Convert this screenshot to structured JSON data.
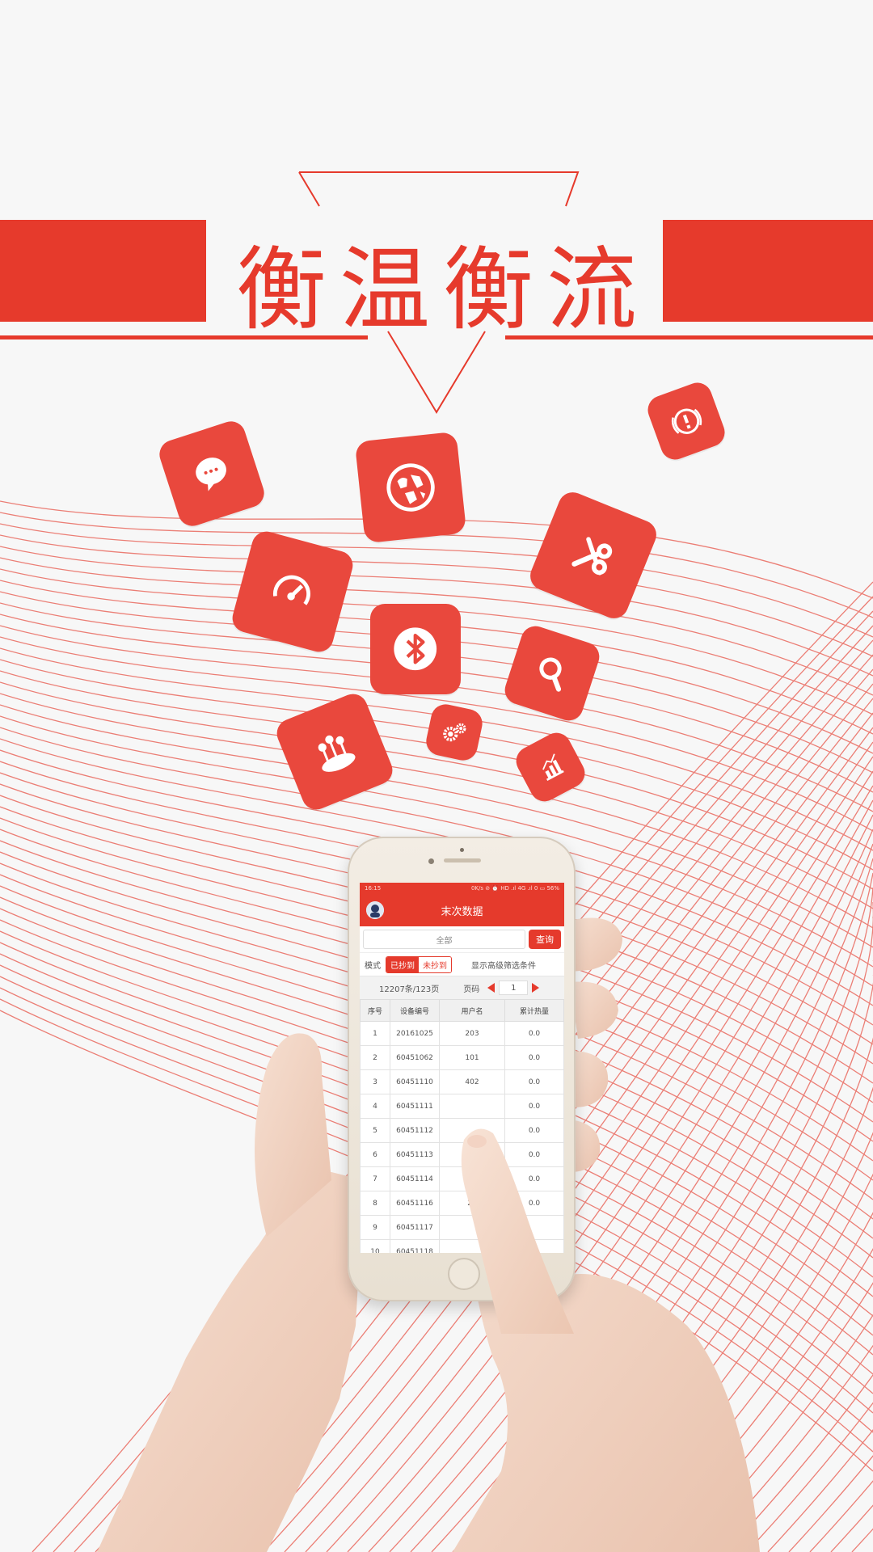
{
  "brand": {
    "title": "衡温衡流",
    "accent": "#e63a2c"
  },
  "icons": [
    "chat-bubble-icon",
    "globe-icon",
    "alert-icon",
    "speedometer-icon",
    "tools-icon",
    "bluetooth-icon",
    "search-icon",
    "network-icon",
    "gears-icon",
    "chart-icon"
  ],
  "phone": {
    "status": {
      "time": "16:15",
      "right": "0K/s ⊘ ⏰ HD .ıl 4G .ıl 0 ▭ 56%"
    },
    "appbar": {
      "title": "末次数据"
    },
    "search": {
      "value": "全部",
      "button": "查询"
    },
    "mode": {
      "label": "模式",
      "on": "已抄到",
      "off": "未抄到",
      "advanced": "显示高级筛选条件"
    },
    "pager": {
      "summary": "12207条/123页",
      "label": "页码",
      "page": "1"
    },
    "table": {
      "headers": [
        "序号",
        "设备编号",
        "用户名",
        "累计热量"
      ],
      "rows": [
        [
          "1",
          "20161025",
          "203",
          "0.0"
        ],
        [
          "2",
          "60451062",
          "101",
          "0.0"
        ],
        [
          "3",
          "60451110",
          "402",
          "0.0"
        ],
        [
          "4",
          "60451111",
          "",
          "0.0"
        ],
        [
          "5",
          "60451112",
          "",
          "0.0"
        ],
        [
          "6",
          "60451113",
          "",
          "0.0"
        ],
        [
          "7",
          "60451114",
          "",
          "0.0"
        ],
        [
          "8",
          "60451116",
          "20",
          "0.0"
        ],
        [
          "9",
          "60451117",
          "",
          ""
        ],
        [
          "10",
          "60451118",
          "",
          ""
        ]
      ]
    }
  }
}
